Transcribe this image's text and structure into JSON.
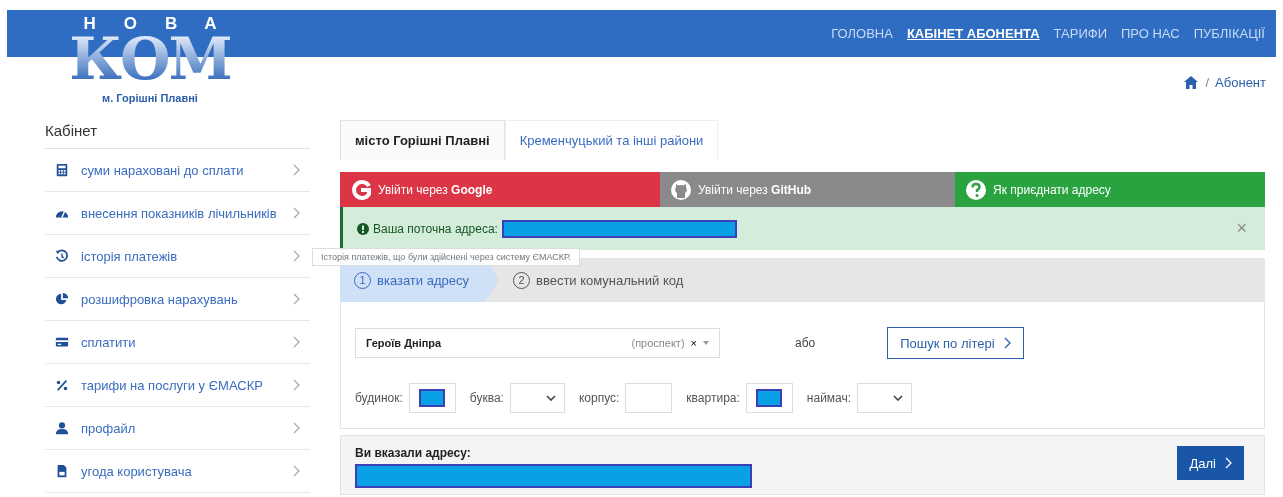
{
  "header": {
    "logo_top": "НОВА",
    "logo_main": "КОМ",
    "city": "м. Горішні Плавні"
  },
  "nav": [
    {
      "label": "ГОЛОВНА",
      "selected": false
    },
    {
      "label": "КАБІНЕТ АБОНЕНТА",
      "selected": true
    },
    {
      "label": "ТАРИФИ",
      "selected": false
    },
    {
      "label": "ПРО НАС",
      "selected": false
    },
    {
      "label": "ПУБЛІКАЦІЇ",
      "selected": false
    }
  ],
  "breadcrumb": {
    "separator": "/",
    "current": "Абонент"
  },
  "sidebar": {
    "title": "Кабінет",
    "items": [
      {
        "label": "суми нараховані до сплати"
      },
      {
        "label": "внесення показників лічильників"
      },
      {
        "label": "історія платежів"
      },
      {
        "label": "розшифровка нарахувань"
      },
      {
        "label": "сплатити"
      },
      {
        "label": "тарифи на послуги у ЄМАСКР"
      },
      {
        "label": "профайл"
      },
      {
        "label": "угода користувача"
      }
    ]
  },
  "tabs": [
    {
      "label": "місто Горішні Плавні",
      "selected": true
    },
    {
      "label": "Кременчуцький та інші райони",
      "selected": false
    }
  ],
  "login_bar": [
    {
      "kind": "google",
      "label": "Увійти через **Google**"
    },
    {
      "kind": "github",
      "label": "Увійти через **GitHub**"
    },
    {
      "kind": "help",
      "label": "Як приєднати адресу"
    }
  ],
  "alert": {
    "label": "Ваша поточна адреса:",
    "close": "×"
  },
  "tooltip": {
    "text": "Історія платежів, що були здійснені через систему ЄМАСКР."
  },
  "steps": [
    {
      "number": "1",
      "label": "вказати адресу",
      "selected": true
    },
    {
      "number": "2",
      "label": "ввести комунальний код",
      "selected": false
    }
  ],
  "address": {
    "street": "Героїв Дніпра",
    "street_type": "(проспект)",
    "clear": "×",
    "or": "або",
    "search_button": "Пошук по літері"
  },
  "fields": [
    {
      "kind": "input",
      "label": "будинок:",
      "filled": true
    },
    {
      "kind": "select",
      "label": "буква:"
    },
    {
      "kind": "input",
      "label": "корпус:",
      "filled": false
    },
    {
      "kind": "input",
      "label": "квартира:",
      "filled": true
    },
    {
      "kind": "select",
      "label": "наймач:"
    }
  ],
  "summary": {
    "label": "Ви вказали адресу:",
    "next_button": "Далі"
  }
}
